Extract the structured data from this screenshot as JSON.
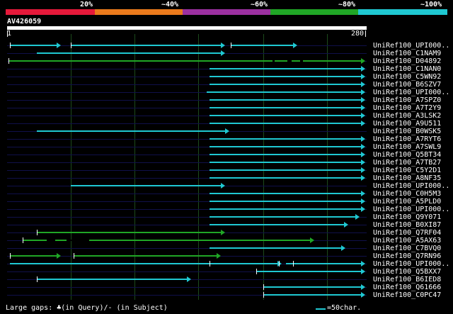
{
  "legend": {
    "labels": [
      "20%",
      "~40%",
      "~60%",
      "~80%",
      "~100%"
    ],
    "colors": [
      "#e5193a",
      "#ea7a1c",
      "#9b30a0",
      "#20a626",
      "#1fc8d2"
    ]
  },
  "query": {
    "name": "AV426059",
    "start": "1",
    "end": "280"
  },
  "colors": {
    "cyan": "#1fc8d2",
    "green": "#20a626"
  },
  "hits": [
    {
      "name": "UniRef100_UPI000..",
      "color": "cyan",
      "segments": [
        [
          14,
          86
        ],
        [
          100,
          318
        ],
        [
          326,
          420
        ]
      ],
      "ticks": [
        14,
        100,
        326
      ]
    },
    {
      "name": "UniRef100_C1NAM9",
      "color": "cyan",
      "segments": [
        [
          52,
          318
        ]
      ],
      "ticks": []
    },
    {
      "name": "UniRef100_D04892",
      "color": "green",
      "segments": [
        [
          12,
          516
        ]
      ],
      "ticks": [
        12
      ],
      "gaps": [
        [
          385,
          388
        ],
        [
          406,
          412
        ],
        [
          424,
          428
        ]
      ]
    },
    {
      "name": "UniRef100_C1NAN0",
      "color": "cyan",
      "segments": [
        [
          296,
          516
        ]
      ],
      "ticks": []
    },
    {
      "name": "UniRef100_C5WN92",
      "color": "cyan",
      "segments": [
        [
          296,
          516
        ]
      ],
      "ticks": []
    },
    {
      "name": "UniRef100_B6SZV7",
      "color": "cyan",
      "segments": [
        [
          296,
          516
        ]
      ],
      "ticks": []
    },
    {
      "name": "UniRef100_UPI000..",
      "color": "cyan",
      "segments": [
        [
          292,
          516
        ]
      ],
      "ticks": []
    },
    {
      "name": "UniRef100_A7SPZ0",
      "color": "cyan",
      "segments": [
        [
          296,
          516
        ]
      ],
      "ticks": []
    },
    {
      "name": "UniRef100_A7T2Y9",
      "color": "cyan",
      "segments": [
        [
          296,
          516
        ]
      ],
      "ticks": []
    },
    {
      "name": "UniRef100_A3LSK2",
      "color": "cyan",
      "segments": [
        [
          296,
          516
        ]
      ],
      "ticks": []
    },
    {
      "name": "UniRef100_A9U511",
      "color": "cyan",
      "segments": [
        [
          296,
          516
        ]
      ],
      "ticks": []
    },
    {
      "name": "UniRef100_B0WSK5",
      "color": "cyan",
      "segments": [
        [
          52,
          324
        ]
      ],
      "ticks": []
    },
    {
      "name": "UniRef100_A7RYT6",
      "color": "cyan",
      "segments": [
        [
          296,
          516
        ]
      ],
      "ticks": []
    },
    {
      "name": "UniRef100_A7SWL9",
      "color": "cyan",
      "segments": [
        [
          296,
          516
        ]
      ],
      "ticks": []
    },
    {
      "name": "UniRef100_Q5BT34",
      "color": "cyan",
      "segments": [
        [
          296,
          516
        ]
      ],
      "ticks": []
    },
    {
      "name": "UniRef100_A7TB27",
      "color": "cyan",
      "segments": [
        [
          296,
          516
        ]
      ],
      "ticks": []
    },
    {
      "name": "UniRef100_C5Y2D1",
      "color": "cyan",
      "segments": [
        [
          296,
          516
        ]
      ],
      "ticks": []
    },
    {
      "name": "UniRef100_A8NF35",
      "color": "cyan",
      "segments": [
        [
          296,
          516
        ]
      ],
      "ticks": []
    },
    {
      "name": "UniRef100_UPI000..",
      "color": "cyan",
      "segments": [
        [
          100,
          318
        ]
      ],
      "ticks": []
    },
    {
      "name": "UniRef100_C0H5M3",
      "color": "cyan",
      "segments": [
        [
          296,
          516
        ]
      ],
      "ticks": []
    },
    {
      "name": "UniRef100_A5PLD0",
      "color": "cyan",
      "segments": [
        [
          296,
          516
        ]
      ],
      "ticks": []
    },
    {
      "name": "UniRef100_UPI000..",
      "color": "cyan",
      "segments": [
        [
          296,
          516
        ]
      ],
      "ticks": []
    },
    {
      "name": "UniRef100_Q9Y071",
      "color": "cyan",
      "segments": [
        [
          296,
          508
        ]
      ],
      "ticks": []
    },
    {
      "name": "UniRef100_B0XI87",
      "color": "cyan",
      "segments": [
        [
          296,
          492
        ]
      ],
      "ticks": []
    },
    {
      "name": "UniRef100_Q7RF04",
      "color": "green",
      "segments": [
        [
          52,
          318
        ]
      ],
      "ticks": [
        52
      ]
    },
    {
      "name": "UniRef100_A5AX63",
      "color": "green",
      "segments": [
        [
          32,
          444
        ]
      ],
      "ticks": [
        32
      ],
      "gaps": [
        [
          66,
          78
        ],
        [
          94,
          126
        ]
      ]
    },
    {
      "name": "UniRef100_C7BVQ0",
      "color": "cyan",
      "segments": [
        [
          296,
          488
        ]
      ],
      "ticks": []
    },
    {
      "name": "UniRef100_Q7RN96",
      "color": "green",
      "segments": [
        [
          14,
          86
        ],
        [
          104,
          312
        ]
      ],
      "ticks": [
        14,
        104
      ]
    },
    {
      "name": "UniRef100_UPI000..",
      "color": "cyan",
      "segments": [
        [
          14,
          398
        ],
        [
          404,
          516
        ]
      ],
      "ticks": [
        296,
        394,
        414
      ]
    },
    {
      "name": "UniRef100_Q5BXX7",
      "color": "cyan",
      "segments": [
        [
          362,
          516
        ]
      ],
      "ticks": [
        362
      ]
    },
    {
      "name": "UniRef100_B6IED8",
      "color": "cyan",
      "segments": [
        [
          52,
          270
        ]
      ],
      "ticks": [
        52
      ]
    },
    {
      "name": "UniRef100_Q61666",
      "color": "cyan",
      "segments": [
        [
          372,
          516
        ]
      ],
      "ticks": [
        372
      ]
    },
    {
      "name": "UniRef100_C0PC47",
      "color": "cyan",
      "segments": [
        [
          372,
          516
        ]
      ],
      "ticks": [
        372
      ]
    }
  ],
  "footer": {
    "gaps_text": "Large gaps: ♣(in Query)/- (in Subject)",
    "scale_text": "=50char."
  }
}
